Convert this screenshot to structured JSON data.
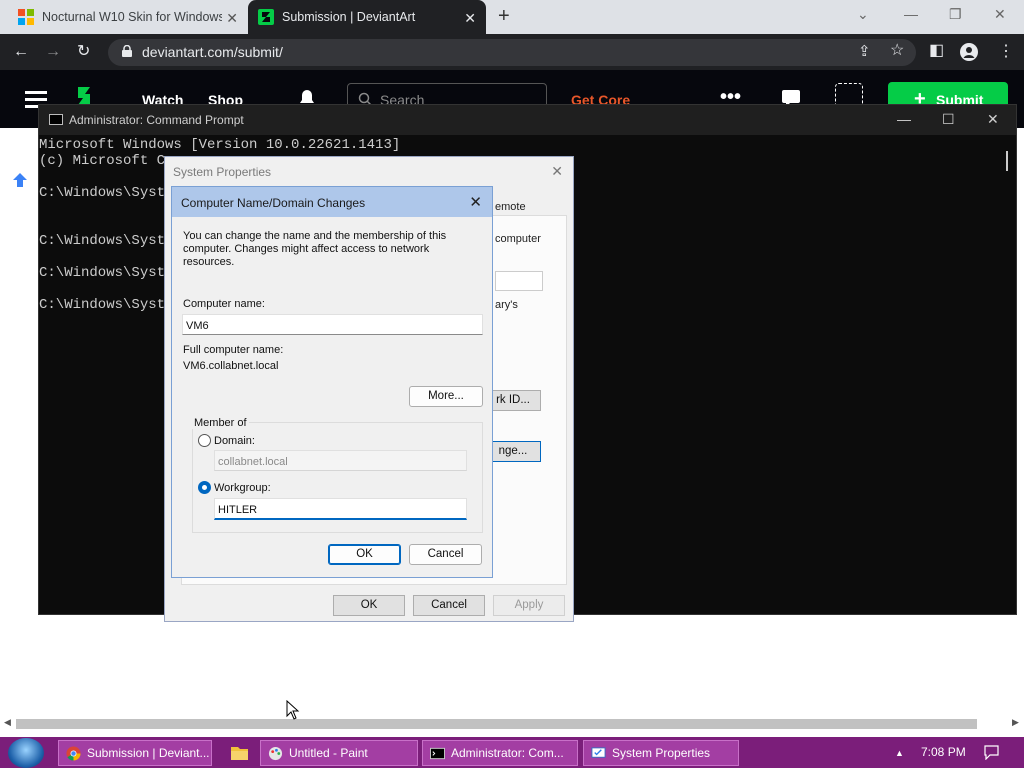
{
  "browser": {
    "tabs": [
      {
        "title": "Nocturnal W10 Skin for Windows",
        "close": "✕"
      },
      {
        "title": "Submission | DeviantArt",
        "close": "✕"
      }
    ],
    "new_tab": "+",
    "url": "deviantart.com/submit/"
  },
  "deviantart": {
    "nav": [
      "Watch",
      "Shop"
    ],
    "search_placeholder": "Search",
    "get_core": "Get Core",
    "submit": "Submit"
  },
  "cmd": {
    "title": "Administrator: Command Prompt",
    "lines": [
      "Microsoft Windows [Version 10.0.22621.1413]",
      "(c) Microsoft Co",
      "",
      "C:\\Windows\\Syste",
      "",
      "",
      "C:\\Windows\\Syste",
      "",
      "C:\\Windows\\Syste",
      "",
      "C:\\Windows\\Syste"
    ]
  },
  "system_properties": {
    "title": "System Properties",
    "fragments": {
      "remote": "emote",
      "computer": "computer",
      "library": "ary's",
      "network_id": "rk ID...",
      "change": "nge..."
    },
    "buttons": {
      "ok": "OK",
      "cancel": "Cancel",
      "apply": "Apply"
    }
  },
  "computer_name_dialog": {
    "title": "Computer Name/Domain Changes",
    "description": "You can change the name and the membership of this computer. Changes might affect access to network resources.",
    "computer_name_label": "Computer name:",
    "computer_name_value": "VM6",
    "full_name_label": "Full computer name:",
    "full_name_value": "VM6.collabnet.local",
    "more_button": "More...",
    "member_of_label": "Member of",
    "domain_label": "Domain:",
    "domain_value": "collabnet.local",
    "domain_selected": false,
    "workgroup_label": "Workgroup:",
    "workgroup_value": "HITLER",
    "workgroup_selected": true,
    "ok": "OK",
    "cancel": "Cancel"
  },
  "taskbar": {
    "items": [
      {
        "label": "Submission | Deviant..."
      },
      {
        "label": "Untitled - Paint"
      },
      {
        "label": "Administrator: Com..."
      },
      {
        "label": "System Properties"
      }
    ],
    "tray_arrow": "▲",
    "time": "7:08 PM"
  }
}
